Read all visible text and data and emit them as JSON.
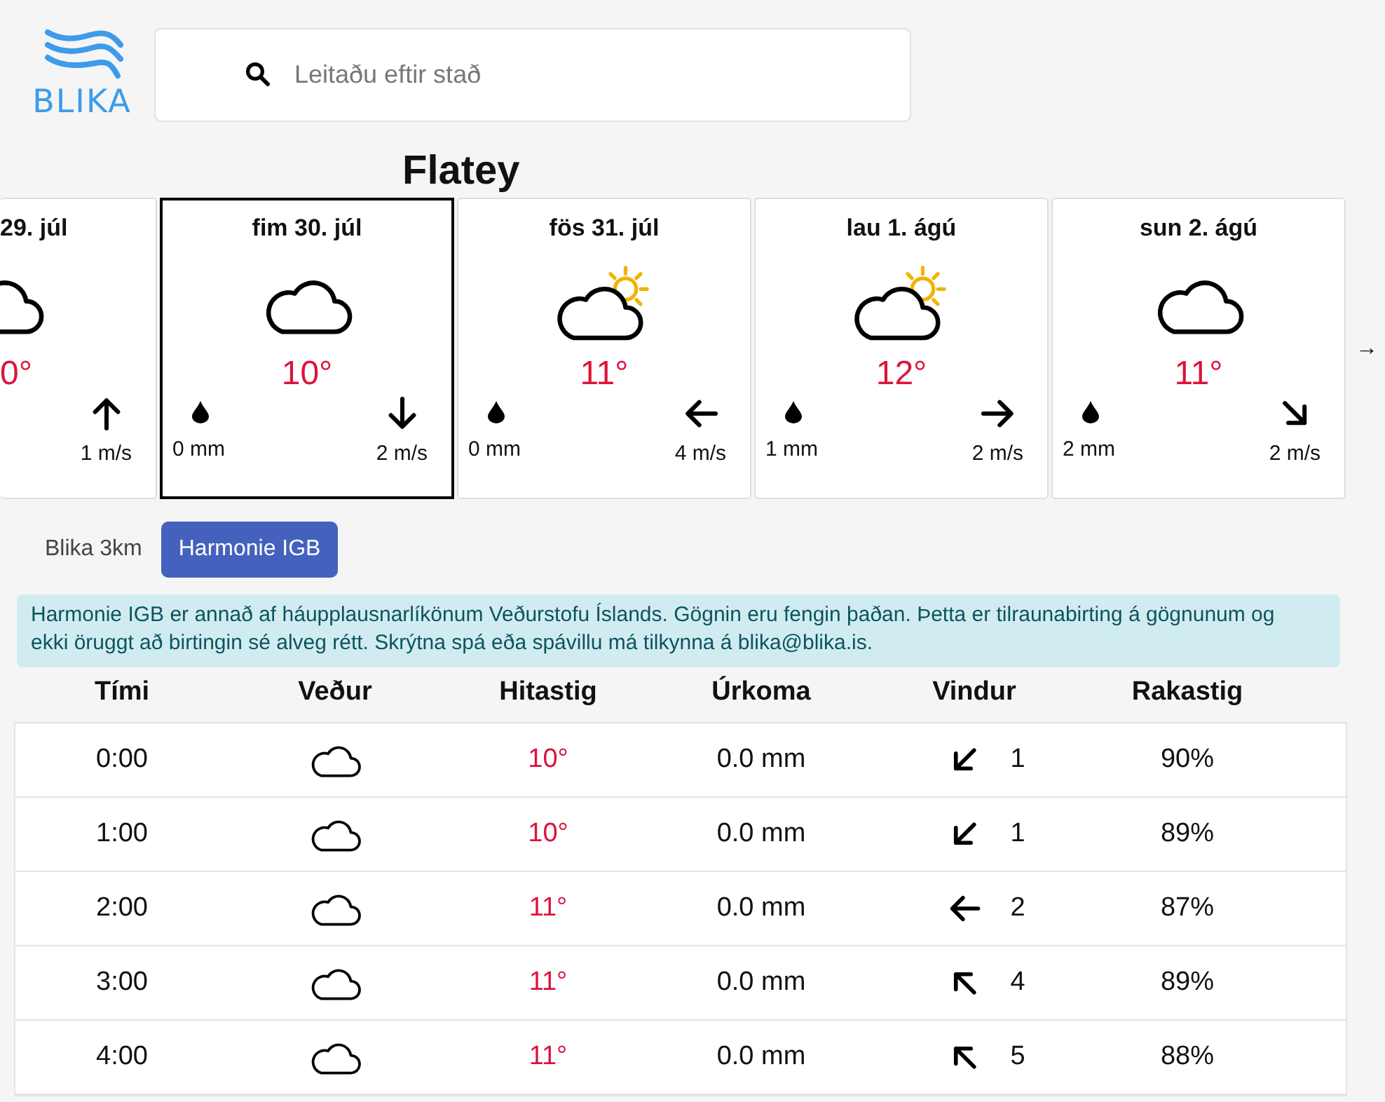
{
  "logo": {
    "text": "BLIKA"
  },
  "search": {
    "placeholder": "Leitaðu eftir stað"
  },
  "location": "Flatey",
  "days": [
    {
      "kind": "partial",
      "date": "29. júl",
      "weather": {
        "kind": "cloudy"
      },
      "temperature": "0°",
      "wind_arrow": {
        "kind": "n"
      },
      "wind": "1 m/s",
      "selected": false
    },
    {
      "kind": "full",
      "date": "fim 30. júl",
      "weather": {
        "kind": "cloudy"
      },
      "temperature": "10°",
      "precipitation": "0 mm",
      "wind_arrow": {
        "kind": "s"
      },
      "wind": "2 m/s",
      "selected": true
    },
    {
      "kind": "full",
      "date": "fös 31. júl",
      "weather": {
        "kind": "partly-sunny"
      },
      "temperature": "11°",
      "precipitation": "0 mm",
      "wind_arrow": {
        "kind": "w"
      },
      "wind": "4 m/s",
      "selected": false
    },
    {
      "kind": "full",
      "date": "lau 1. ágú",
      "weather": {
        "kind": "partly-sunny"
      },
      "temperature": "12°",
      "precipitation": "1 mm",
      "wind_arrow": {
        "kind": "e"
      },
      "wind": "2 m/s",
      "selected": false
    },
    {
      "kind": "full",
      "date": "sun 2. ágú",
      "weather": {
        "kind": "cloudy"
      },
      "temperature": "11°",
      "precipitation": "2 mm",
      "wind_arrow": {
        "kind": "se"
      },
      "wind": "2 m/s",
      "selected": false
    }
  ],
  "next_arrow": "→",
  "models": [
    {
      "label": "Blika 3km",
      "selected": false
    },
    {
      "label": "Harmonie IGB",
      "selected": true
    }
  ],
  "notice": "Harmonie IGB er annað af háupplausnarlíkönum Veðurstofu Íslands. Gögnin eru fengin þaðan. Þetta er tilraunabirting á gögnunum og ekki öruggt að birtingin sé alveg rétt. Skrýtna spá eða spávillu má tilkynna á blika@blika.is.",
  "table": {
    "columns": [
      "Tími",
      "Veður",
      "Hitastig",
      "Úrkoma",
      "Vindur",
      "Rakastig"
    ],
    "rows": [
      {
        "time": "0:00",
        "weather": {
          "kind": "cloudy"
        },
        "temperature": "10°",
        "precipitation": "0.0 mm",
        "wind_arrow": {
          "kind": "sw"
        },
        "wind": "1",
        "humidity": "90%"
      },
      {
        "time": "1:00",
        "weather": {
          "kind": "cloudy"
        },
        "temperature": "10°",
        "precipitation": "0.0 mm",
        "wind_arrow": {
          "kind": "sw"
        },
        "wind": "1",
        "humidity": "89%"
      },
      {
        "time": "2:00",
        "weather": {
          "kind": "cloudy"
        },
        "temperature": "11°",
        "precipitation": "0.0 mm",
        "wind_arrow": {
          "kind": "w"
        },
        "wind": "2",
        "humidity": "87%"
      },
      {
        "time": "3:00",
        "weather": {
          "kind": "cloudy"
        },
        "temperature": "11°",
        "precipitation": "0.0 mm",
        "wind_arrow": {
          "kind": "nw"
        },
        "wind": "4",
        "humidity": "89%"
      },
      {
        "time": "4:00",
        "weather": {
          "kind": "cloudy"
        },
        "temperature": "11°",
        "precipitation": "0.0 mm",
        "wind_arrow": {
          "kind": "nw"
        },
        "wind": "5",
        "humidity": "88%"
      }
    ]
  }
}
